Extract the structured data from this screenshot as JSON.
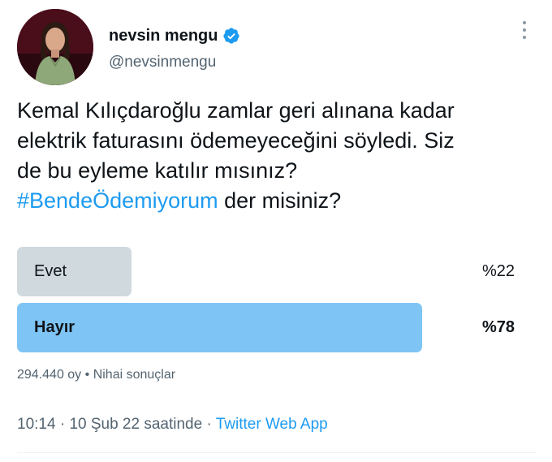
{
  "user": {
    "display_name": "nevsin mengu",
    "handle": "@nevsinmengu"
  },
  "tweet": {
    "text_line1": "Kemal Kılıçdaroğlu zamlar geri alınana kadar",
    "text_line2": "elektrik faturasını ödemeyeceğini söyledi. Siz",
    "text_line3": "de bu eyleme katılır mısınız?",
    "hashtag": "#BendeÖdemiyorum",
    "text_after_hashtag": " der misiniz?"
  },
  "poll": {
    "options": [
      {
        "label": "Evet",
        "percent_text": "%22",
        "percent": 22,
        "winner": false
      },
      {
        "label": "Hayır",
        "percent_text": "%78",
        "percent": 78,
        "winner": true
      }
    ],
    "votes": "294.440 oy",
    "separator": " • ",
    "status": "Nihai sonuçlar"
  },
  "meta": {
    "time": "10:14",
    "separator": " · ",
    "date": "10 Şub 22 saatinde",
    "app": "Twitter Web App"
  },
  "colors": {
    "accent": "#1d9bf0",
    "winner_bar": "#7ec5f5",
    "loser_bar": "#cfd9de",
    "secondary_text": "#536471"
  },
  "icons": {
    "verified": "verified-badge-icon",
    "more": "more-options-icon"
  }
}
